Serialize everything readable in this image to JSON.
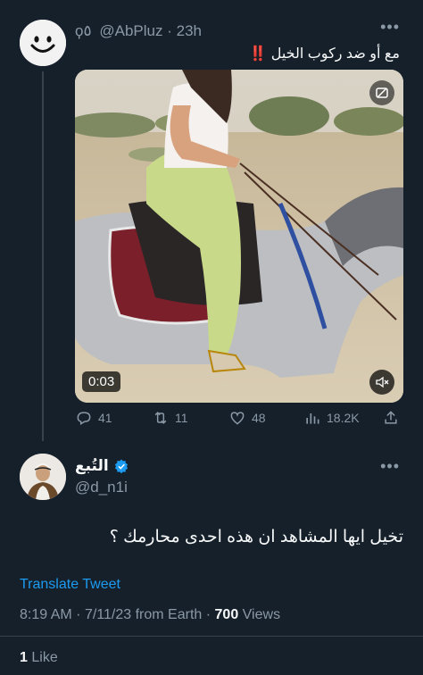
{
  "parent_tweet": {
    "display_name": "ϙ٥",
    "handle": "@AbPluz",
    "separator": "·",
    "time": "23h",
    "text": "مع أو ضد ركوب الخيل",
    "text_emoji": "‼️",
    "media": {
      "duration": "0:03"
    },
    "actions": {
      "replies": "41",
      "retweets": "11",
      "likes": "48",
      "views": "18.2K"
    }
  },
  "main_tweet": {
    "display_name": "التُبع",
    "handle": "@d_n1i",
    "text": "تخيل ايها المشاهد ان هذه احدى محارمك ؟",
    "translate_label": "Translate Tweet",
    "time": "8:19 AM",
    "date": "7/11/23",
    "source": "from Earth",
    "views_count": "700",
    "views_label": "Views",
    "likes_count": "1",
    "likes_label": "Like"
  },
  "colors": {
    "background": "#15202b",
    "link": "#1d9bf0",
    "muted": "#8b98a5",
    "verified": "#1d9bf0"
  }
}
